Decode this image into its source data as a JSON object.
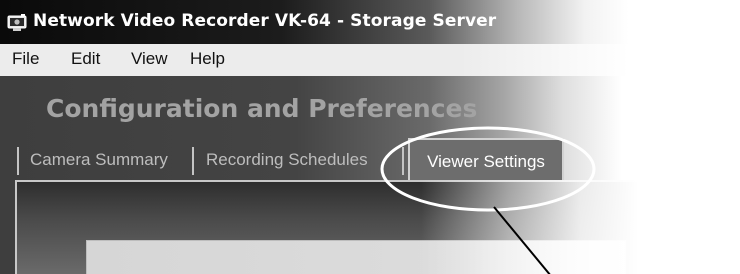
{
  "window": {
    "title": "Network Video Recorder VK-64 - Storage Server",
    "icon": "app-camera-icon"
  },
  "menu": {
    "items": [
      {
        "label": "File"
      },
      {
        "label": "Edit"
      },
      {
        "label": "View"
      },
      {
        "label": "Help"
      }
    ]
  },
  "page": {
    "title": "Configuration and Preferences"
  },
  "tabs": [
    {
      "label": "Camera Summary",
      "active": false
    },
    {
      "label": "Recording Schedules",
      "active": false
    },
    {
      "label": "Viewer Settings",
      "active": true
    }
  ],
  "callout": {
    "target": "Viewer Settings",
    "style": "ellipse highlight with pointer line"
  }
}
